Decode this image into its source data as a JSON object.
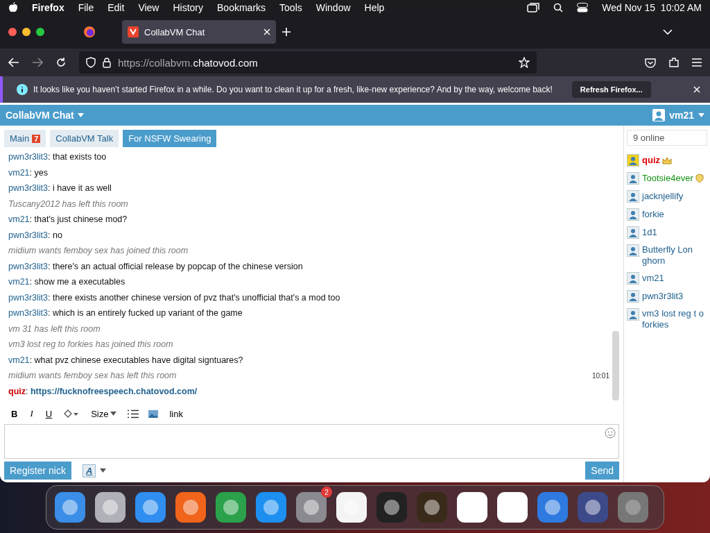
{
  "menubar": {
    "app": "Firefox",
    "items": [
      "File",
      "Edit",
      "View",
      "History",
      "Bookmarks",
      "Tools",
      "Window",
      "Help"
    ],
    "clock": "Wed Nov 15  10:02 AM"
  },
  "browser": {
    "tab_title": "CollabVM Chat",
    "url_dim": "https://collabvm.",
    "url_host": "chatovod.com",
    "notice": "It looks like you haven’t started Firefox in a while. Do you want to clean it up for a fresh, like-new experience? And by the way, welcome back!",
    "notice_button": "Refresh Firefox..."
  },
  "header": {
    "title": "CollabVM Chat",
    "user": "vm21"
  },
  "rooms": [
    {
      "label": "Main",
      "badge": "7",
      "selected": false
    },
    {
      "label": "CollabVM Talk",
      "selected": false
    },
    {
      "label": "For NSFW Swearing",
      "selected": true
    }
  ],
  "author_separator": ":",
  "messages": [
    {
      "kind": "message",
      "author": "pwn3r3lit3",
      "text": "that exists too"
    },
    {
      "kind": "message",
      "author": "vm21",
      "text": "yes"
    },
    {
      "kind": "message",
      "author": "pwn3r3lit3",
      "text": "i have it as well"
    },
    {
      "kind": "event",
      "text": "Tuscany2012 has left this room"
    },
    {
      "kind": "message",
      "author": "vm21",
      "text": "that's just chinese mod?"
    },
    {
      "kind": "message",
      "author": "pwn3r3lit3",
      "text": "no"
    },
    {
      "kind": "event",
      "text": "midium wants femboy sex has joined this room"
    },
    {
      "kind": "message",
      "author": "pwn3r3lit3",
      "text": "there's an actual official release by popcap of the chinese version"
    },
    {
      "kind": "message",
      "author": "vm21",
      "text": "show me a executables"
    },
    {
      "kind": "message",
      "author": "pwn3r3lit3",
      "text": "there exists another chinese version of pvz that's unofficial that's a mod too"
    },
    {
      "kind": "message",
      "author": "pwn3r3lit3",
      "text": "which is an entirely fucked up variant of the game"
    },
    {
      "kind": "event",
      "text": "vm 31 has left this room"
    },
    {
      "kind": "event",
      "text": "vm3 lost reg to forkies has joined this room"
    },
    {
      "kind": "message",
      "author": "vm21",
      "text": "what pvz chinese executables have digital signtuares?"
    },
    {
      "kind": "event",
      "text": "midium wants femboy sex has left this room",
      "time": "10:01"
    },
    {
      "kind": "link",
      "author": "quiz",
      "color": "#cc0000",
      "text": "https://fucknofreespeech.chatovod.com/"
    }
  ],
  "toolbar": {
    "bold": "B",
    "italic": "I",
    "underline": "U",
    "size": "Size",
    "link": "link"
  },
  "bottom": {
    "register": "Register nick",
    "style": "A",
    "send": "Send"
  },
  "online": {
    "count": "9 online",
    "users": [
      {
        "name": "quiz",
        "color": "#dd0000",
        "highlighted": true,
        "kind": "admin"
      },
      {
        "name": "Tootsie4ever",
        "color": "#139313",
        "highlighted": false,
        "kind": "moderator"
      },
      {
        "name": "jacknjellify",
        "color": "#22628f",
        "highlighted": false,
        "kind": "user"
      },
      {
        "name": "forkie",
        "color": "#22628f",
        "highlighted": false,
        "kind": "user"
      },
      {
        "name": "1d1",
        "color": "#22628f",
        "highlighted": false,
        "kind": "user"
      },
      {
        "name": "Butterfly Lon ghorn",
        "color": "#22628f",
        "highlighted": false,
        "kind": "user"
      },
      {
        "name": "vm21",
        "color": "#22628f",
        "highlighted": false,
        "kind": "user"
      },
      {
        "name": "pwn3r3lit3",
        "color": "#22628f",
        "highlighted": false,
        "kind": "user"
      },
      {
        "name": "vm3 lost reg t o forkies",
        "color": "#22628f",
        "highlighted": false,
        "kind": "user"
      }
    ]
  },
  "dock": {
    "settings_badge": "2"
  }
}
